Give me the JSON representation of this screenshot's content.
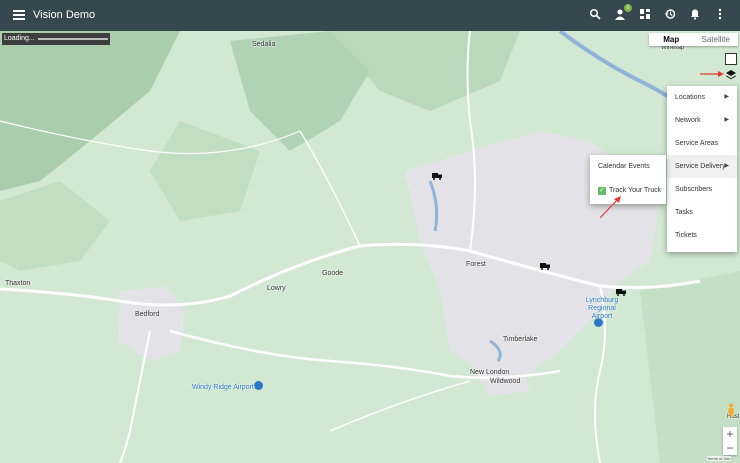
{
  "header": {
    "title": "Vision Demo",
    "badge_count": "6"
  },
  "map": {
    "loading_text": "Loading...",
    "map_type": {
      "map": "Map",
      "satellite": "Satellite"
    },
    "places": [
      {
        "name": "Sedalia"
      },
      {
        "name": "Forest"
      },
      {
        "name": "Goode"
      },
      {
        "name": "Lowry"
      },
      {
        "name": "Bedford"
      },
      {
        "name": "Thaxton"
      },
      {
        "name": "Timberlake"
      },
      {
        "name": "New London"
      },
      {
        "name": "Wildwood"
      },
      {
        "name": "Lynchburg Regional Airport"
      },
      {
        "name": "Windy Ridge Airport"
      },
      {
        "name": "Winesap"
      },
      {
        "name": "Hust"
      }
    ],
    "terms": "Terms of Use"
  },
  "layers_menu": {
    "items": [
      {
        "label": "Locations",
        "has_submenu": true
      },
      {
        "label": "Network",
        "has_submenu": true
      },
      {
        "label": "Service Areas",
        "has_submenu": false
      },
      {
        "label": "Service Delivery",
        "has_submenu": true
      },
      {
        "label": "Subscribers",
        "has_submenu": false
      },
      {
        "label": "Tasks",
        "has_submenu": false
      },
      {
        "label": "Tickets",
        "has_submenu": false
      }
    ]
  },
  "service_delivery_submenu": {
    "items": [
      {
        "label": "Calendar Events",
        "checked": false
      },
      {
        "label": "Track Your Truck",
        "checked": true
      }
    ]
  },
  "colors": {
    "header_bg": "#37474f",
    "checkbox": "#66bb6a",
    "map_green": "#cfe5cf",
    "urban_gray": "#e3e3e7"
  }
}
